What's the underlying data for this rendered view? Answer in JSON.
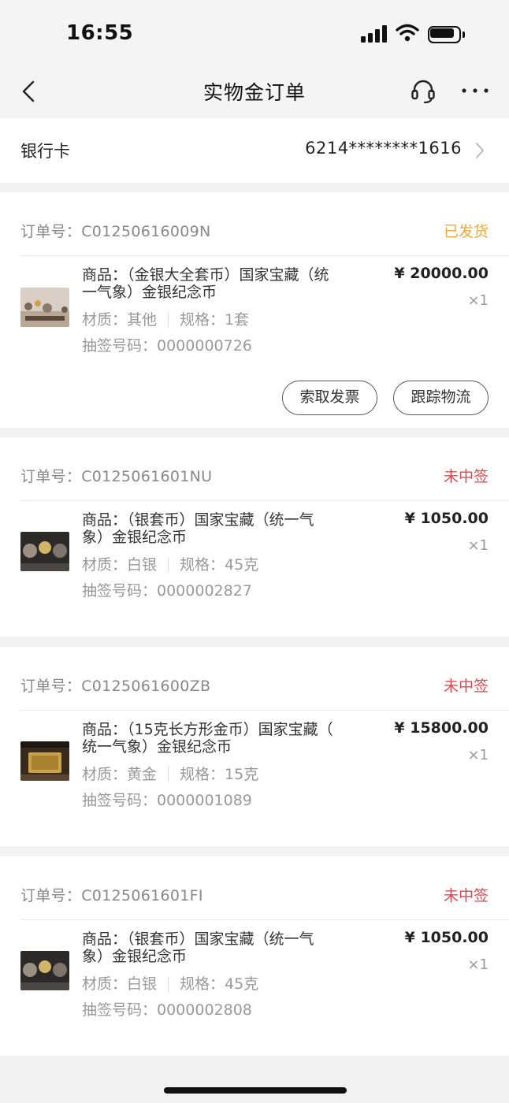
{
  "status_bar": {
    "time": "16:55"
  },
  "nav": {
    "title": "实物金订单"
  },
  "bank": {
    "label": "银行卡",
    "number": "6214********1616"
  },
  "colors": {
    "status_shipped": "#f0a838",
    "status_not_won": "#e0464c"
  },
  "orders": [
    {
      "order_no": "订单号：C01250616009N",
      "status": "已发货",
      "product_line1": "商品：（金银大全套币）国家宝藏（统",
      "product_line2": "一气象）金银纪念币",
      "material": "材质：其他",
      "spec": "规格：1套",
      "lottery": "抽签号码：0000000726",
      "price": "¥ 20000.00",
      "qty": "×1",
      "buttons": {
        "invoice": "索取发票",
        "logistics": "跟踪物流"
      }
    },
    {
      "order_no": "订单号：C0125061601NU",
      "status": "未中签",
      "product_line1": "商品：（银套币）国家宝藏（统一气",
      "product_line2": "象）金银纪念币",
      "material": "材质：白银",
      "spec": "规格：45克",
      "lottery": "抽签号码：0000002827",
      "price": "¥ 1050.00",
      "qty": "×1"
    },
    {
      "order_no": "订单号：C0125061600ZB",
      "status": "未中签",
      "product_line1": "商品：（15克长方形金币）国家宝藏（",
      "product_line2": "统一气象）金银纪念币",
      "material": "材质：黄金",
      "spec": "规格：15克",
      "lottery": "抽签号码：0000001089",
      "price": "¥ 15800.00",
      "qty": "×1"
    },
    {
      "order_no": "订单号：C0125061601FI",
      "status": "未中签",
      "product_line1": "商品：（银套币）国家宝藏（统一气",
      "product_line2": "象）金银纪念币",
      "material": "材质：白银",
      "spec": "规格：45克",
      "lottery": "抽签号码：0000002808",
      "price": "¥ 1050.00",
      "qty": "×1"
    }
  ]
}
